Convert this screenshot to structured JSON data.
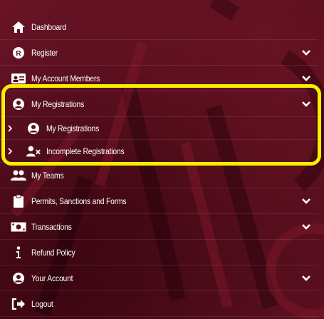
{
  "menu": {
    "items": [
      {
        "label": "Dashboard",
        "icon": "home-icon",
        "has_chevron": false
      },
      {
        "label": "Register",
        "icon": "registered-icon",
        "has_chevron": true
      },
      {
        "label": "My Account Members",
        "icon": "id-card-icon",
        "has_chevron": true
      },
      {
        "label": "My Registrations",
        "icon": "user-circle-icon",
        "has_chevron": true,
        "expanded": true
      },
      {
        "label": "My Teams",
        "icon": "users-icon",
        "has_chevron": false
      },
      {
        "label": "Permits, Sanctions and Forms",
        "icon": "clipboard-icon",
        "has_chevron": true
      },
      {
        "label": "Transactions",
        "icon": "money-bill-icon",
        "has_chevron": true
      },
      {
        "label": "Refund Policy",
        "icon": "info-icon",
        "has_chevron": false
      },
      {
        "label": "Your Account",
        "icon": "user-circle-icon",
        "has_chevron": true
      },
      {
        "label": "Logout",
        "icon": "sign-out-icon",
        "has_chevron": false
      }
    ],
    "sub_items": [
      {
        "label": "My Registrations",
        "icon": "user-circle-icon"
      },
      {
        "label": "Incomplete Registrations",
        "icon": "user-times-icon"
      }
    ]
  },
  "colors": {
    "background": "#5b0f1f",
    "highlight": "#f6f000",
    "text": "#ffffff"
  }
}
